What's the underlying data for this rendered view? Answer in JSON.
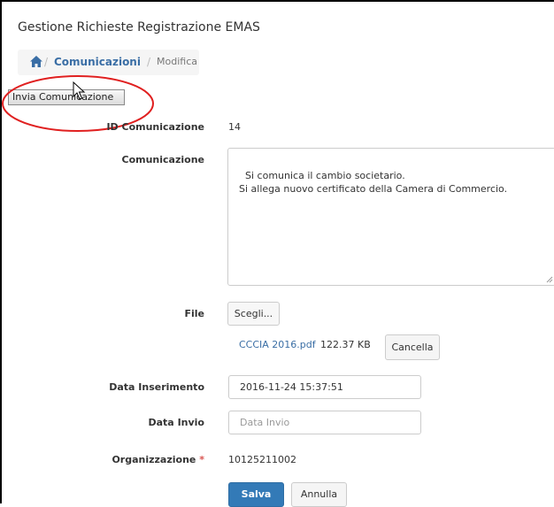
{
  "app": {
    "title": "Gestione Richieste Registrazione EMAS"
  },
  "breadcrumb": {
    "link": "Comunicazioni",
    "separator": "/",
    "current": "Modifica"
  },
  "toolbar": {
    "send_label": "Invia Comunicazione"
  },
  "form": {
    "id": {
      "label": "ID Comunicazione",
      "value": "14"
    },
    "communication": {
      "label": "Comunicazione",
      "value": "Si comunica il cambio societario.\nSi allega nuovo certificato della Camera di Commercio."
    },
    "file": {
      "label": "File",
      "choose_label": "Scegli...",
      "filename": "CCCIA 2016.pdf",
      "size": "122.37 KB",
      "delete_label": "Cancella"
    },
    "date_inserted": {
      "label": "Data Inserimento",
      "value": "2016-11-24 15:37:51"
    },
    "date_sent": {
      "label": "Data Invio",
      "placeholder": "Data Invio"
    },
    "organization": {
      "label": "Organizzazione",
      "required_mark": "*",
      "value": "10125211002"
    },
    "actions": {
      "save_label": "Salva",
      "cancel_label": "Annulla"
    }
  },
  "colors": {
    "primary": "#337ab7",
    "link": "#3a6ea5",
    "required": "#d9534f",
    "annotation": "#e02020"
  },
  "icons": {
    "home": "home-icon",
    "cursor": "mouse-pointer-icon",
    "resize": "resize-grip-icon"
  }
}
